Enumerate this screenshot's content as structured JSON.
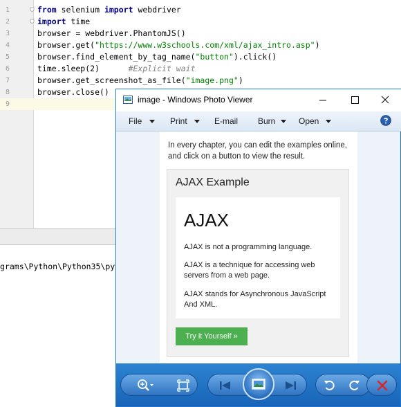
{
  "editor": {
    "lines": [
      {
        "num": "1",
        "parts": [
          {
            "t": "from",
            "c": "kw"
          },
          {
            "t": " selenium ",
            "c": ""
          },
          {
            "t": "import",
            "c": "kw"
          },
          {
            "t": " webdriver",
            "c": ""
          }
        ]
      },
      {
        "num": "2",
        "parts": [
          {
            "t": "import",
            "c": "kw"
          },
          {
            "t": " time",
            "c": ""
          }
        ]
      },
      {
        "num": "3",
        "parts": [
          {
            "t": "browser = webdriver.PhantomJS()",
            "c": ""
          }
        ]
      },
      {
        "num": "4",
        "parts": [
          {
            "t": "browser.get(",
            "c": ""
          },
          {
            "t": "\"https://www.w3schools.com/xml/ajax_intro.asp\"",
            "c": "str"
          },
          {
            "t": ")",
            "c": ""
          }
        ]
      },
      {
        "num": "5",
        "parts": [
          {
            "t": "browser.find_element_by_tag_name(",
            "c": ""
          },
          {
            "t": "\"button\"",
            "c": "str"
          },
          {
            "t": ").click()",
            "c": ""
          }
        ]
      },
      {
        "num": "6",
        "parts": [
          {
            "t": "time.sleep(2)      ",
            "c": ""
          },
          {
            "t": "#Explicit wait",
            "c": "cm"
          }
        ]
      },
      {
        "num": "7",
        "parts": [
          {
            "t": "browser.get_screenshot_as_file(",
            "c": ""
          },
          {
            "t": "\"image.png\"",
            "c": "str"
          },
          {
            "t": ")",
            "c": ""
          }
        ]
      },
      {
        "num": "8",
        "parts": [
          {
            "t": "browser.close()",
            "c": ""
          }
        ]
      },
      {
        "num": "9",
        "parts": []
      }
    ]
  },
  "console": {
    "text": "grams\\Python\\Python35\\py"
  },
  "viewer": {
    "title": "image - Windows Photo Viewer",
    "menu": {
      "file": "File",
      "print": "Print",
      "email": "E-mail",
      "burn": "Burn",
      "open": "Open"
    },
    "page": {
      "intro": "In every chapter, you can edit the examples online, and click on a button to view the result.",
      "example_title": "AJAX Example",
      "heading": "AJAX",
      "para1": "AJAX is not a programming language.",
      "para2": "AJAX is a technique for accessing web servers from a web page.",
      "para3": "AJAX stands for Asynchronous JavaScript And XML.",
      "button": "Try it Yourself »"
    }
  },
  "colors": {
    "keyword": "#000080",
    "string": "#008000",
    "comment": "#808080",
    "try_button": "#4caf50",
    "viewer_bar": "#1f6fc2"
  }
}
